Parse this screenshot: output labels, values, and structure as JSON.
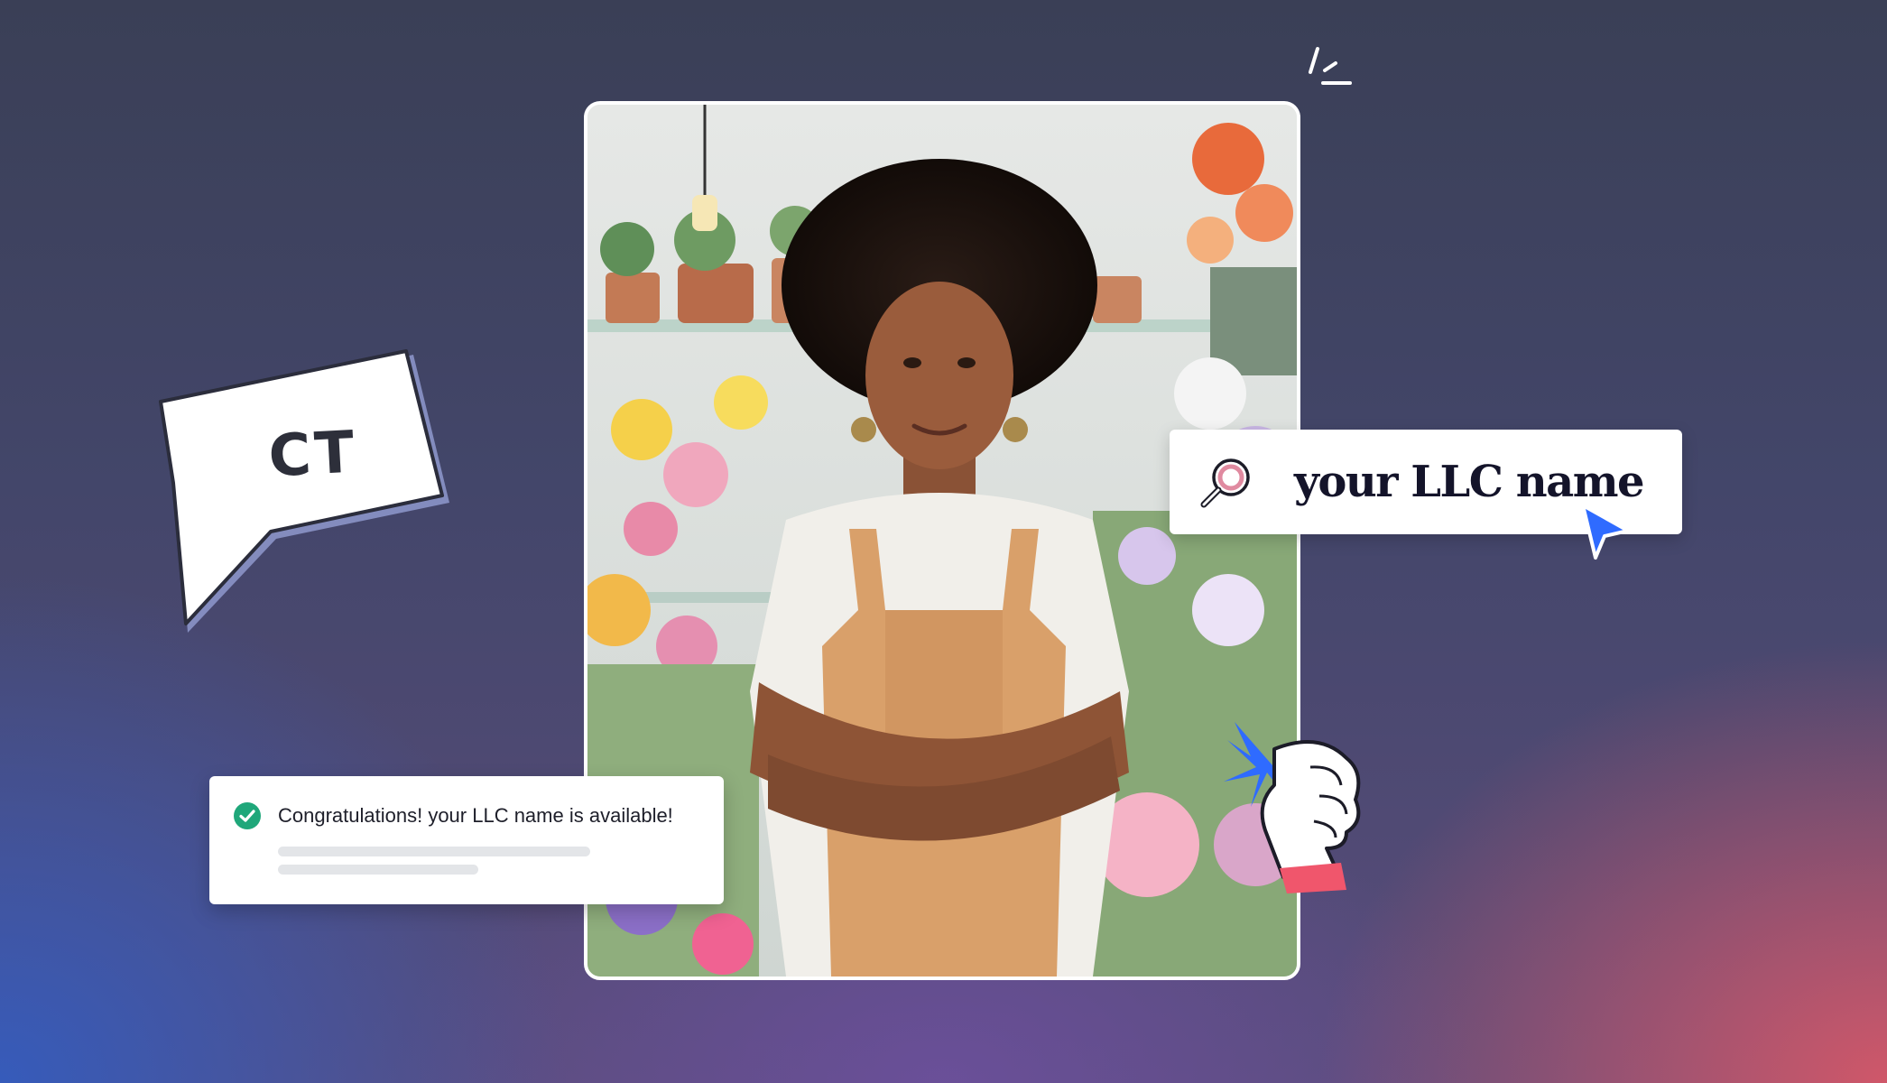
{
  "speech_bubble": {
    "text": "CT"
  },
  "search": {
    "query": "your LLC name",
    "icon": "search-icon"
  },
  "notification": {
    "message": "Congratulations! your LLC name is available!",
    "icon": "check-circle-icon",
    "status_color": "#1fa77a"
  },
  "colors": {
    "cursor": "#2f6bff",
    "accent_star": "#2f6bff",
    "cuff": "#f0566c",
    "search_ring": "#e08aa0"
  }
}
